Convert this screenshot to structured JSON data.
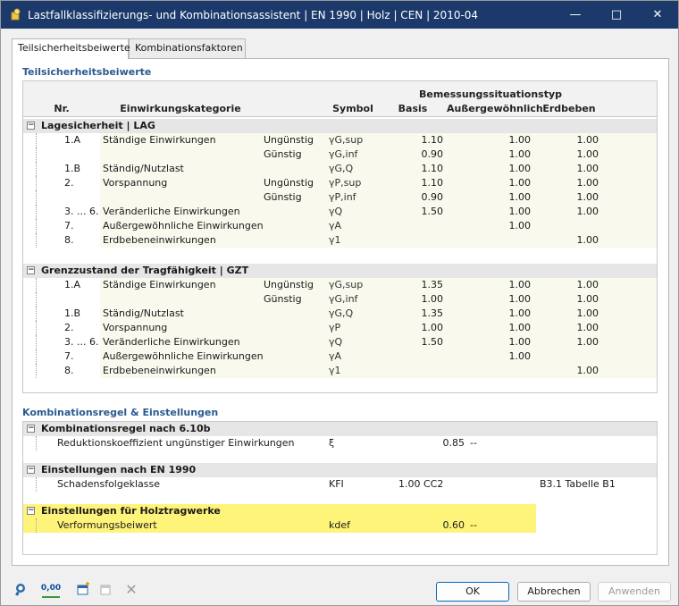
{
  "window": {
    "title": "Lastfallklassifizierungs- und Kombinationsassistent | EN 1990 | Holz | CEN | 2010-04",
    "minimize_icon": "minimize-icon",
    "maximize_icon": "maximize-icon",
    "close_icon": "close-icon"
  },
  "tabs": [
    {
      "label": "Teilsicherheitsbeiwerte",
      "active": true
    },
    {
      "label": "Kombinationsfaktoren",
      "active": false
    }
  ],
  "psf": {
    "section_title": "Teilsicherheitsbeiwerte",
    "header": {
      "nr": "Nr.",
      "kategorie": "Einwirkungskategorie",
      "symbol": "Symbol",
      "group": "Bemessungssituationstyp",
      "basis": "Basis",
      "ausser": "Außergewöhnlich",
      "erdbeben": "Erdbeben"
    },
    "groups": [
      {
        "title": "Lagesicherheit | LAG",
        "rows": [
          {
            "nr": "1.A",
            "cat": "Ständige Einwirkungen",
            "eff": "Ungünstig",
            "sym": "γG,sup",
            "basis": "1.10",
            "ausser": "1.00",
            "erd": "1.00"
          },
          {
            "nr": "",
            "cat": "",
            "eff": "Günstig",
            "sym": "γG,inf",
            "basis": "0.90",
            "ausser": "1.00",
            "erd": "1.00"
          },
          {
            "nr": "1.B",
            "cat": "Ständig/Nutzlast",
            "eff": "",
            "sym": "γG,Q",
            "basis": "1.10",
            "ausser": "1.00",
            "erd": "1.00"
          },
          {
            "nr": "2.",
            "cat": "Vorspannung",
            "eff": "Ungünstig",
            "sym": "γP,sup",
            "basis": "1.10",
            "ausser": "1.00",
            "erd": "1.00"
          },
          {
            "nr": "",
            "cat": "",
            "eff": "Günstig",
            "sym": "γP,inf",
            "basis": "0.90",
            "ausser": "1.00",
            "erd": "1.00"
          },
          {
            "nr": "3. ... 6.",
            "cat": "Veränderliche Einwirkungen",
            "eff": "",
            "sym": "γQ",
            "basis": "1.50",
            "ausser": "1.00",
            "erd": "1.00"
          },
          {
            "nr": "7.",
            "cat": "Außergewöhnliche Einwirkungen",
            "eff": "",
            "sym": "γA",
            "basis": "",
            "ausser": "1.00",
            "erd": ""
          },
          {
            "nr": "8.",
            "cat": "Erdbebeneinwirkungen",
            "eff": "",
            "sym": "γ1",
            "basis": "",
            "ausser": "",
            "erd": "1.00"
          }
        ]
      },
      {
        "title": "Grenzzustand der Tragfähigkeit | GZT",
        "rows": [
          {
            "nr": "1.A",
            "cat": "Ständige Einwirkungen",
            "eff": "Ungünstig",
            "sym": "γG,sup",
            "basis": "1.35",
            "ausser": "1.00",
            "erd": "1.00"
          },
          {
            "nr": "",
            "cat": "",
            "eff": "Günstig",
            "sym": "γG,inf",
            "basis": "1.00",
            "ausser": "1.00",
            "erd": "1.00"
          },
          {
            "nr": "1.B",
            "cat": "Ständig/Nutzlast",
            "eff": "",
            "sym": "γG,Q",
            "basis": "1.35",
            "ausser": "1.00",
            "erd": "1.00"
          },
          {
            "nr": "2.",
            "cat": "Vorspannung",
            "eff": "",
            "sym": "γP",
            "basis": "1.00",
            "ausser": "1.00",
            "erd": "1.00"
          },
          {
            "nr": "3. ... 6.",
            "cat": "Veränderliche Einwirkungen",
            "eff": "",
            "sym": "γQ",
            "basis": "1.50",
            "ausser": "1.00",
            "erd": "1.00"
          },
          {
            "nr": "7.",
            "cat": "Außergewöhnliche Einwirkungen",
            "eff": "",
            "sym": "γA",
            "basis": "",
            "ausser": "1.00",
            "erd": ""
          },
          {
            "nr": "8.",
            "cat": "Erdbebeneinwirkungen",
            "eff": "",
            "sym": "γ1",
            "basis": "",
            "ausser": "",
            "erd": "1.00"
          }
        ]
      }
    ]
  },
  "komb": {
    "section_title": "Kombinationsregel & Einstellungen",
    "groups": [
      {
        "title": "Kombinationsregel nach 6.10b",
        "highlight": false,
        "rows": [
          {
            "label": "Reduktionskoeffizient ungünstiger Einwirkungen",
            "sym": "ξ",
            "value": "0.85",
            "unit": "--",
            "ref": ""
          }
        ]
      },
      {
        "title": "Einstellungen nach EN 1990",
        "highlight": false,
        "rows": [
          {
            "label": "Schadensfolgeklasse",
            "sym": "KFI",
            "value": "1.00 CC2",
            "unit": "",
            "ref": "B3.1 Tabelle B1"
          }
        ]
      },
      {
        "title": "Einstellungen für Holztragwerke",
        "highlight": true,
        "rows": [
          {
            "label": "Verformungsbeiwert",
            "sym": "kdef",
            "value": "0.60",
            "unit": "--",
            "ref": ""
          }
        ]
      }
    ]
  },
  "bottom": {
    "ok": "OK",
    "cancel": "Abbrechen",
    "apply": "Anwenden",
    "decimal_label": "0,00"
  }
}
